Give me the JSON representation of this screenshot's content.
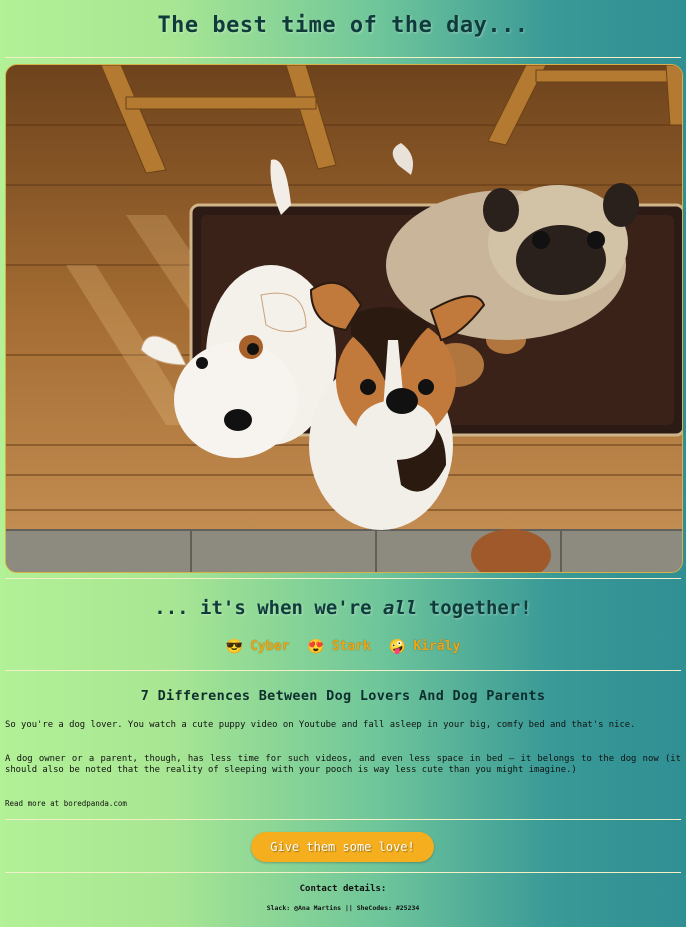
{
  "header": {
    "title": "The best time of the day..."
  },
  "hero": {
    "alt": "Three dogs sitting on a rug looking up"
  },
  "subtitle": {
    "prefix": "... it's when we're ",
    "emphasis": "all",
    "suffix": " together!"
  },
  "dogs": [
    {
      "icon": "smiling-face-with-sunglasses-icon",
      "emoji": "😎",
      "name": "Cyber"
    },
    {
      "icon": "smiling-face-with-heart-eyes-icon",
      "emoji": "😍",
      "name": "Stark"
    },
    {
      "icon": "zany-face-icon",
      "emoji": "🤪",
      "name": "Király"
    }
  ],
  "article": {
    "title": "7 Differences Between Dog Lovers And Dog Parents",
    "paragraph1": "So you're a dog lover. You watch a cute puppy video on Youtube and fall asleep in your big, comfy bed and that's nice.",
    "paragraph2": "A dog owner or a parent, though, has less time for such videos, and even less space in bed – it belongs to the dog now (it should also be noted that the reality of sleeping with your pooch is way less cute than you might imagine.)",
    "read_more": "Read more at boredpanda.com"
  },
  "cta": {
    "label": "Give them some love!"
  },
  "footer": {
    "contact_label": "Contact details:",
    "contact_line": "Slack: @Ana Martins || SheCodes: #25234"
  },
  "colors": {
    "accent": "#f4ae1e",
    "title": "#0f3b3b",
    "gradient_start": "#b2f196",
    "gradient_end": "#2f8f93"
  }
}
